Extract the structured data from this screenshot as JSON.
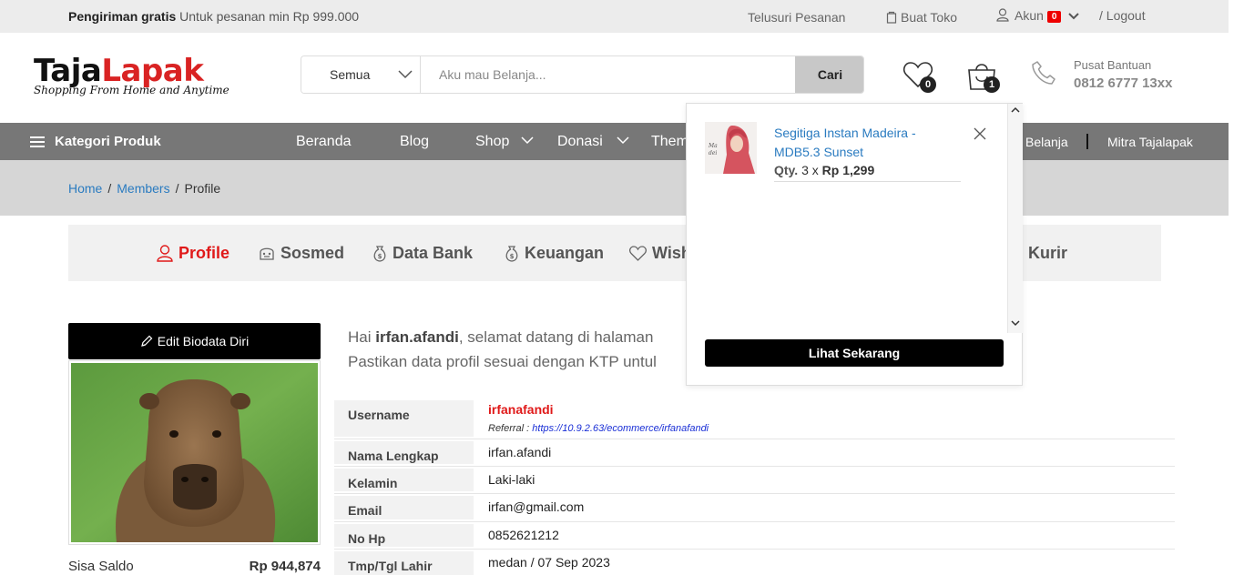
{
  "topbar": {
    "promo_bold": "Pengiriman gratis",
    "promo_text": " Untuk pesanan min Rp 999.000",
    "track_order": "Telusuri Pesanan",
    "open_store": "Buat Toko",
    "account": "Akun",
    "account_badge": "0",
    "logout": "/ Logout"
  },
  "logo": {
    "part1": "Taja",
    "part2": "Lapak",
    "tagline": "Shopping From Home and Anytime"
  },
  "search": {
    "category": "Semua",
    "placeholder": "Aku mau Belanja...",
    "button": "Cari"
  },
  "header": {
    "wishlist_count": "0",
    "cart_count": "1",
    "help_title": "Pusat Bantuan",
    "help_phone": "0812 6777 13xx"
  },
  "nav": {
    "categories": "Kategori Produk",
    "items": [
      "Beranda",
      "Blog",
      "Shop",
      "Donasi",
      "Them"
    ],
    "right_items": [
      "Belanja",
      "Mitra Tajalapak"
    ]
  },
  "breadcrumb": {
    "home": "Home",
    "members": "Members",
    "current": "Profile",
    "sep": "/"
  },
  "tabs": [
    {
      "label": "Profile"
    },
    {
      "label": "Sosmed"
    },
    {
      "label": "Data Bank"
    },
    {
      "label": "Keuangan"
    },
    {
      "label": "Wish"
    },
    {
      "label": "i Kurir"
    }
  ],
  "left": {
    "edit_button": "Edit Biodata Diri",
    "saldo_label": "Sisa Saldo",
    "saldo_value": "Rp 944,874"
  },
  "greeting": {
    "hai": "Hai ",
    "name": "irfan.afandi",
    "line1_rest": ", selamat datang di halaman",
    "line2": "Pastikan data profil sesuai dengan KTP untul"
  },
  "profile": {
    "username_label": "Username",
    "username_value": "irfanafandi",
    "referral_label": "Referral : ",
    "referral_link": "https://10.9.2.63/ecommerce/irfanafandi",
    "rows": [
      {
        "label": "Nama Lengkap",
        "value": "irfan.afandi"
      },
      {
        "label": "Kelamin",
        "value": "Laki-laki"
      },
      {
        "label": "Email",
        "value": "irfan@gmail.com"
      },
      {
        "label": "No Hp",
        "value": "0852621212"
      },
      {
        "label": "Tmp/Tgl Lahir",
        "value": "medan / 07 Sep 2023"
      }
    ]
  },
  "cart": {
    "product_name": "Segitiga Instan Madeira - MDB5.3 Sunset",
    "qty_label": "Qty.",
    "qty_text": " 3 x ",
    "price": "Rp 1,299",
    "view_button": "Lihat Sekarang"
  }
}
